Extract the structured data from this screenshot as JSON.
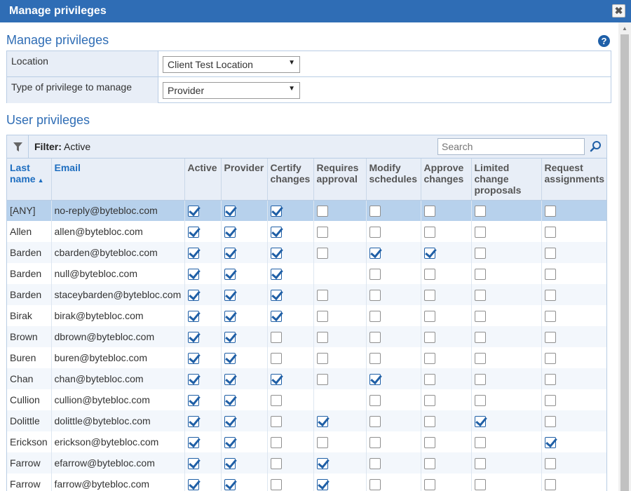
{
  "window": {
    "title": "Manage privileges",
    "close_label": "✖"
  },
  "page": {
    "title": "Manage privileges",
    "help_label": "?"
  },
  "form": {
    "location_label": "Location",
    "location_value": "Client Test Location",
    "type_label": "Type of privilege to manage",
    "type_value": "Provider"
  },
  "section": {
    "title": "User privileges"
  },
  "toolbar": {
    "filter_label": "Filter:",
    "filter_value": "Active",
    "search_placeholder": "Search"
  },
  "columns": [
    "Last name",
    "Email",
    "Active",
    "Provider",
    "Certify changes",
    "Requires approval",
    "Modify schedules",
    "Approve changes",
    "Limited change proposals",
    "Request assignments"
  ],
  "sort_indicator": "▲",
  "rows": [
    {
      "last_name": "[ANY]",
      "email": "no-reply@bytebloc.com",
      "checks": [
        true,
        true,
        true,
        false,
        false,
        false,
        false,
        false
      ]
    },
    {
      "last_name": "Allen",
      "email": "allen@bytebloc.com",
      "checks": [
        true,
        true,
        true,
        false,
        false,
        false,
        false,
        false
      ]
    },
    {
      "last_name": "Barden",
      "email": "cbarden@bytebloc.com",
      "checks": [
        true,
        true,
        true,
        false,
        true,
        true,
        false,
        false
      ]
    },
    {
      "last_name": "Barden",
      "email": "null@bytebloc.com",
      "checks": [
        true,
        true,
        true,
        null,
        false,
        false,
        false,
        false
      ]
    },
    {
      "last_name": "Barden",
      "email": "staceybarden@bytebloc.com",
      "checks": [
        true,
        true,
        true,
        false,
        false,
        false,
        false,
        false
      ]
    },
    {
      "last_name": "Birak",
      "email": "birak@bytebloc.com",
      "checks": [
        true,
        true,
        true,
        false,
        false,
        false,
        false,
        false
      ]
    },
    {
      "last_name": "Brown",
      "email": "dbrown@bytebloc.com",
      "checks": [
        true,
        true,
        false,
        false,
        false,
        false,
        false,
        false
      ]
    },
    {
      "last_name": "Buren",
      "email": "buren@bytebloc.com",
      "checks": [
        true,
        true,
        false,
        false,
        false,
        false,
        false,
        false
      ]
    },
    {
      "last_name": "Chan",
      "email": "chan@bytebloc.com",
      "checks": [
        true,
        true,
        true,
        false,
        true,
        false,
        false,
        false
      ]
    },
    {
      "last_name": "Cullion",
      "email": "cullion@bytebloc.com",
      "checks": [
        true,
        true,
        false,
        null,
        false,
        false,
        false,
        false
      ]
    },
    {
      "last_name": "Dolittle",
      "email": "dolittle@bytebloc.com",
      "checks": [
        true,
        true,
        false,
        true,
        false,
        false,
        true,
        false
      ]
    },
    {
      "last_name": "Erickson",
      "email": "erickson@bytebloc.com",
      "checks": [
        true,
        true,
        false,
        false,
        false,
        false,
        false,
        true
      ]
    },
    {
      "last_name": "Farrow",
      "email": "efarrow@bytebloc.com",
      "checks": [
        true,
        true,
        false,
        true,
        false,
        false,
        false,
        false
      ]
    },
    {
      "last_name": "Farrow",
      "email": "farrow@bytebloc.com",
      "checks": [
        true,
        true,
        false,
        true,
        false,
        false,
        false,
        false
      ]
    }
  ],
  "colors": {
    "titlebar": "#2f6db5",
    "accent": "#1f5fa6",
    "selected_row": "#b7d1ec",
    "header_bg": "#e8eef7"
  }
}
